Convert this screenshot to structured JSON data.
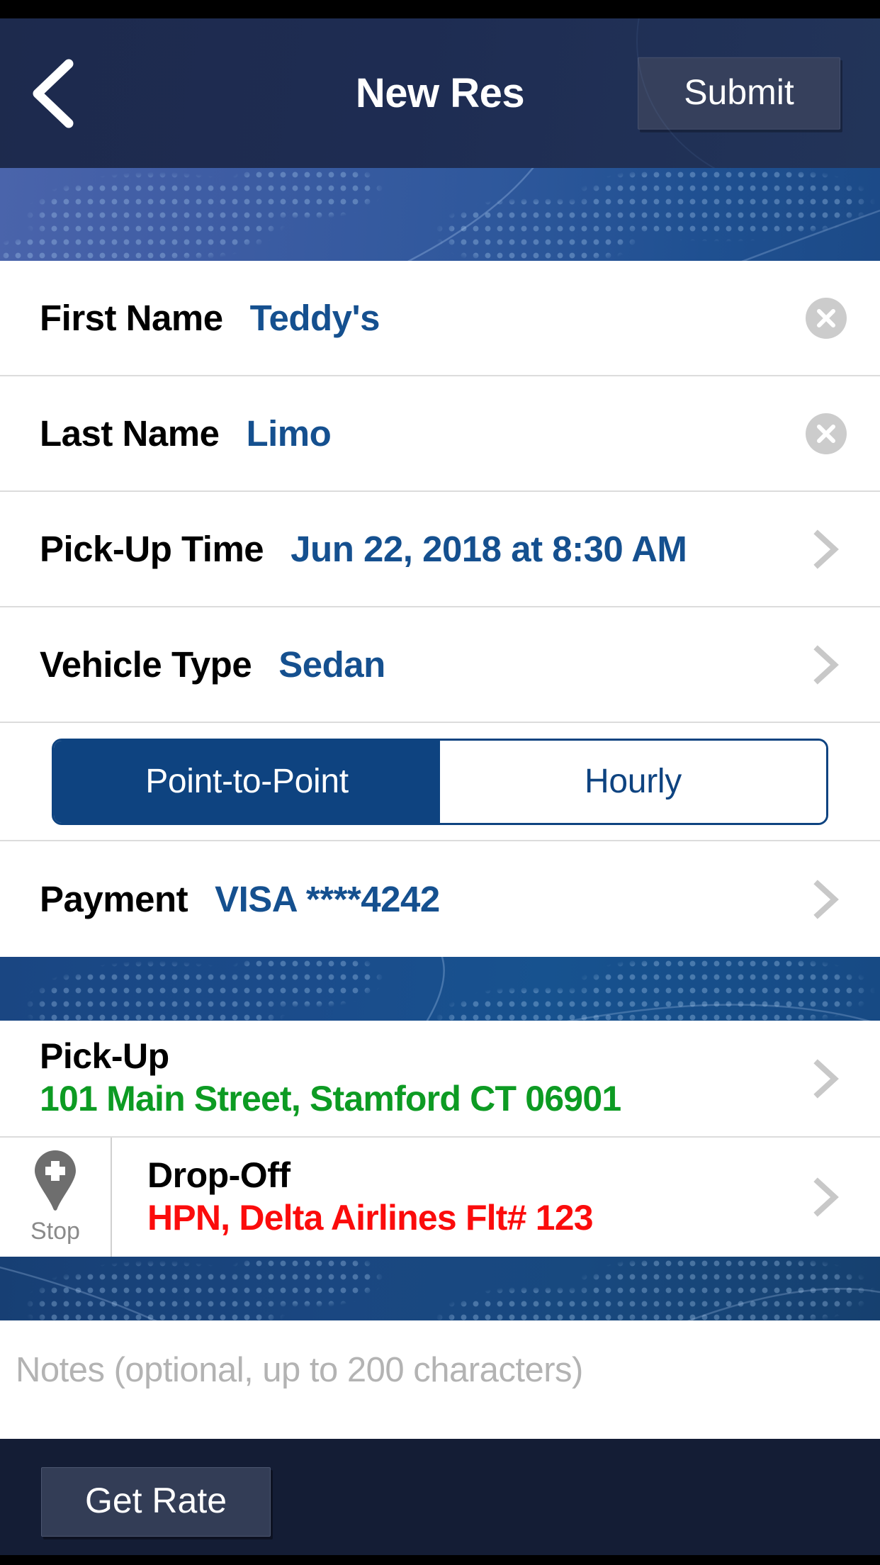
{
  "header": {
    "back_icon": "chevron-left-icon",
    "title": "New Res",
    "submit_label": "Submit"
  },
  "colors": {
    "navbar_bg": "#1e2c52",
    "band_blue": "#3f5da4",
    "value_blue": "#15508f",
    "segment_navy": "#0e4380",
    "pickup_green": "#0d9b23",
    "dropoff_red": "#fb0c0c",
    "clear_gray": "#cccccc",
    "chevron_gray": "#c8c8c8",
    "bottom_bar": "#141d35",
    "action_button": "#36405c"
  },
  "form": {
    "rows": [
      {
        "label": "First Name",
        "value": "Teddy's",
        "accessory": "clear-icon"
      },
      {
        "label": "Last Name",
        "value": "Limo",
        "accessory": "clear-icon"
      },
      {
        "label": "Pick-Up Time",
        "value": "Jun 22, 2018 at 8:30 AM",
        "accessory": "chevron-right-icon"
      },
      {
        "label": "Vehicle Type",
        "value": "Sedan",
        "accessory": "chevron-right-icon"
      }
    ],
    "trip_type": {
      "options": [
        "Point-to-Point",
        "Hourly"
      ],
      "selected": "Point-to-Point"
    },
    "payment": {
      "label": "Payment",
      "value": "VISA ****4242",
      "accessory": "chevron-right-icon"
    }
  },
  "locations": {
    "pickup": {
      "title": "Pick-Up",
      "address": "101 Main Street, Stamford CT 06901",
      "accessory": "chevron-right-icon"
    },
    "dropoff": {
      "title": "Drop-Off",
      "address": "HPN, Delta Airlines Flt# 123",
      "accessory": "chevron-right-icon",
      "stop_button": {
        "icon": "map-pin-plus-icon",
        "label": "Stop"
      }
    }
  },
  "notes": {
    "value": "",
    "placeholder": "Notes (optional, up to 200 characters)"
  },
  "footer": {
    "get_rate_label": "Get Rate"
  }
}
